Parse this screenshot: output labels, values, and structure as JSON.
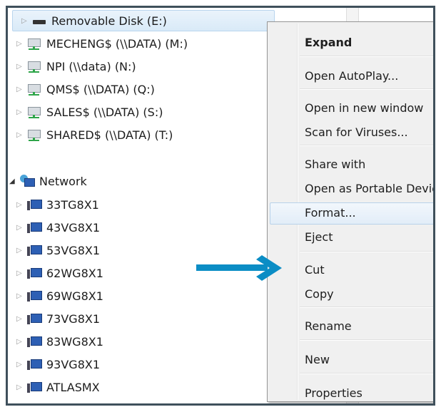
{
  "tree": {
    "drives": [
      {
        "label": "Removable Disk (E:)",
        "icon": "removable-drive-icon"
      },
      {
        "label": "MECHENG$ (\\\\DATA) (M:)",
        "icon": "network-drive-icon"
      },
      {
        "label": "NPI (\\\\data) (N:)",
        "icon": "network-drive-icon"
      },
      {
        "label": "QMS$ (\\\\DATA) (Q:)",
        "icon": "network-drive-icon"
      },
      {
        "label": "SALES$ (\\\\DATA) (S:)",
        "icon": "network-drive-icon"
      },
      {
        "label": "SHARED$ (\\\\DATA) (T:)",
        "icon": "network-drive-icon"
      }
    ],
    "network_label": "Network",
    "computers": [
      "33TG8X1",
      "43VG8X1",
      "53VG8X1",
      "62WG8X1",
      "69WG8X1",
      "73VG8X1",
      "83WG8X1",
      "93VG8X1",
      "ATLASMX"
    ]
  },
  "context_menu": {
    "items": [
      "Expand",
      "Open AutoPlay...",
      "Open in new window",
      "Scan for Viruses...",
      "Share with",
      "Open as Portable Device",
      "Format...",
      "Eject",
      "Cut",
      "Copy",
      "Rename",
      "New",
      "Properties"
    ],
    "highlighted": "Format..."
  },
  "colors": {
    "arrow": "#0b8dc5",
    "frame": "#3f505b"
  }
}
